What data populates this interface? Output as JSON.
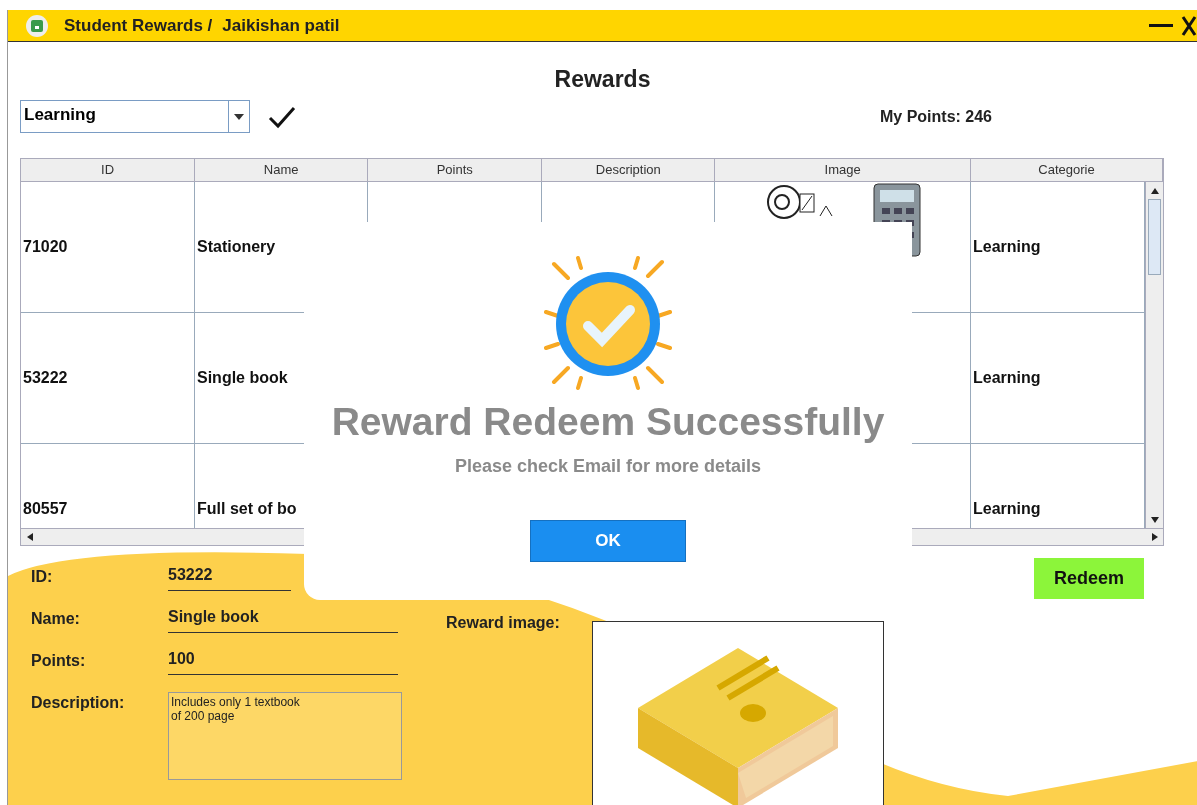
{
  "window": {
    "title": "Student Rewards /",
    "user": "Jaikishan patil"
  },
  "heading": "Rewards",
  "filter": {
    "value": "Learning"
  },
  "points": "My Points: 246",
  "table": {
    "columns": [
      "ID",
      "Name",
      "Points",
      "Description",
      "Image",
      "Categorie"
    ],
    "rows": [
      {
        "id": "71020",
        "name": "Stationery",
        "image_shown": true,
        "category": "Learning"
      },
      {
        "id": "53222",
        "name": "Single book",
        "image_shown": false,
        "category": "Learning"
      },
      {
        "id": "80557",
        "name": "Full set of bo",
        "image_shown": false,
        "category": "Learning"
      }
    ]
  },
  "details": {
    "fields": [
      {
        "label": "ID:",
        "value": "53222",
        "kind": "short"
      },
      {
        "label": "Name:",
        "value": "Single book",
        "kind": "line"
      },
      {
        "label": "Points:",
        "value": "100",
        "kind": "line"
      },
      {
        "label": "Description:",
        "value": "Includes only 1 textbook\nof 200 page",
        "kind": "area"
      }
    ],
    "image_label": "Reward image:"
  },
  "redeem": "Redeem",
  "dialog": {
    "title": "Reward Redeem Successfully",
    "message": "Please check Email for more details",
    "button": "OK"
  }
}
